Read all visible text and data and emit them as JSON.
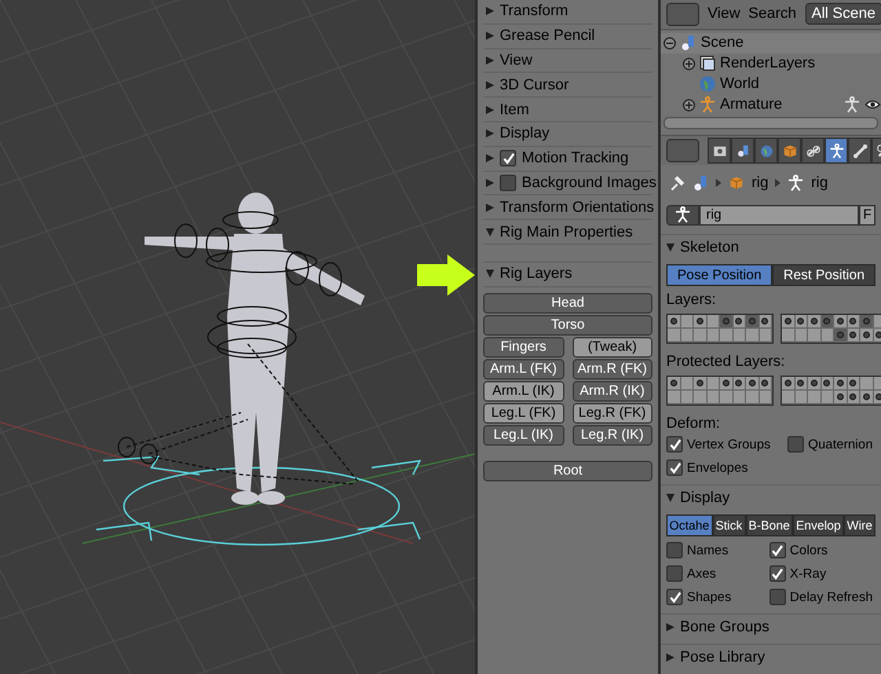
{
  "tool_shelf": {
    "panels": [
      {
        "title": "Transform",
        "expanded": false,
        "kind": "plain"
      },
      {
        "title": "Grease Pencil",
        "expanded": false,
        "kind": "plain"
      },
      {
        "title": "View",
        "expanded": false,
        "kind": "plain"
      },
      {
        "title": "3D Cursor",
        "expanded": false,
        "kind": "plain"
      },
      {
        "title": "Item",
        "expanded": false,
        "kind": "plain"
      },
      {
        "title": "Display",
        "expanded": false,
        "kind": "plain"
      },
      {
        "title": "Motion Tracking",
        "expanded": false,
        "kind": "checkbox",
        "checked": true
      },
      {
        "title": "Background Images",
        "expanded": false,
        "kind": "checkbox",
        "checked": false
      },
      {
        "title": "Transform Orientations",
        "expanded": false,
        "kind": "plain"
      },
      {
        "title": "Rig Main Properties",
        "expanded": true,
        "kind": "plain"
      }
    ],
    "rig_layers": {
      "title": "Rig Layers",
      "expanded": true,
      "rows": [
        [
          {
            "label": "Head",
            "selected": true
          }
        ],
        [
          {
            "label": "Torso",
            "selected": true
          }
        ],
        [
          {
            "label": "Fingers",
            "selected": true
          },
          {
            "label": "(Tweak)",
            "selected": false
          }
        ],
        [
          {
            "label": "Arm.L (FK)",
            "selected": true
          },
          {
            "label": "Arm.R (FK)",
            "selected": true
          }
        ],
        [
          {
            "label": "Arm.L (IK)",
            "selected": false
          },
          {
            "label": "Arm.R (IK)",
            "selected": true
          }
        ],
        [
          {
            "label": "Leg.L (FK)",
            "selected": false
          },
          {
            "label": "Leg.R (FK)",
            "selected": false
          }
        ],
        [
          {
            "label": "Leg.L (IK)",
            "selected": true
          },
          {
            "label": "Leg.R (IK)",
            "selected": true
          }
        ]
      ],
      "root_row": [
        {
          "label": "Root",
          "selected": true
        }
      ]
    }
  },
  "outliner": {
    "menus": [
      "View",
      "Search"
    ],
    "scene_filter": "All Scene",
    "tree": [
      {
        "label": "Scene",
        "kind": "scene",
        "expanded": true,
        "children": [
          {
            "label": "RenderLayers",
            "kind": "render_layers",
            "expanded": false
          },
          {
            "label": "World",
            "kind": "world"
          },
          {
            "label": "Armature",
            "kind": "armature",
            "expanded": false
          }
        ]
      }
    ]
  },
  "properties": {
    "tabs": [
      {
        "kind": "render",
        "selected": false
      },
      {
        "kind": "scene",
        "selected": false
      },
      {
        "kind": "world",
        "selected": false
      },
      {
        "kind": "object",
        "selected": false
      },
      {
        "kind": "constraint",
        "selected": false
      },
      {
        "kind": "armature",
        "selected": true
      },
      {
        "kind": "bone",
        "selected": false
      },
      {
        "kind": "bone_constraint",
        "selected": false
      }
    ],
    "breadcrumb": [
      "rig",
      "rig"
    ],
    "name_field": {
      "value": "rig",
      "button": "F"
    },
    "skeleton": {
      "title": "Skeleton",
      "expanded": true,
      "positions": [
        {
          "label": "Pose Position",
          "selected": true
        },
        {
          "label": "Rest Position",
          "selected": false
        }
      ],
      "layers_label": "Layers:",
      "layers": [
        [
          [
            {
              "used": true,
              "active": false
            },
            {
              "used": false,
              "active": false
            },
            {
              "used": true,
              "active": false
            },
            {
              "used": false,
              "active": false
            },
            {
              "used": true,
              "active": true
            },
            {
              "used": true,
              "active": false
            },
            {
              "used": true,
              "active": true
            },
            {
              "used": true,
              "active": false
            }
          ],
          [
            {
              "used": false,
              "active": false
            },
            {
              "used": false,
              "active": false
            },
            {
              "used": false,
              "active": false
            },
            {
              "used": false,
              "active": false
            },
            {
              "used": false,
              "active": false
            },
            {
              "used": false,
              "active": false
            },
            {
              "used": false,
              "active": false
            },
            {
              "used": false,
              "active": false
            }
          ]
        ],
        [
          [
            {
              "used": true,
              "active": false
            },
            {
              "used": true,
              "active": false
            },
            {
              "used": true,
              "active": false
            },
            {
              "used": true,
              "active": true
            },
            {
              "used": true,
              "active": false
            },
            {
              "used": true,
              "active": false
            },
            {
              "used": true,
              "active": true
            },
            {
              "used": false,
              "active": false
            }
          ],
          [
            {
              "used": false,
              "active": false
            },
            {
              "used": false,
              "active": false
            },
            {
              "used": false,
              "active": false
            },
            {
              "used": false,
              "active": false
            },
            {
              "used": true,
              "active": true
            },
            {
              "used": true,
              "active": false
            },
            {
              "used": true,
              "active": false
            },
            {
              "used": true,
              "active": false
            }
          ]
        ]
      ],
      "protected_label": "Protected Layers:",
      "protected_layers": [
        [
          [
            {
              "used": true,
              "active": false
            },
            {
              "used": false,
              "active": false
            },
            {
              "used": true,
              "active": false
            },
            {
              "used": false,
              "active": false
            },
            {
              "used": true,
              "active": false
            },
            {
              "used": true,
              "active": false
            },
            {
              "used": true,
              "active": false
            },
            {
              "used": true,
              "active": false
            }
          ],
          [
            {
              "used": false,
              "active": false
            },
            {
              "used": false,
              "active": false
            },
            {
              "used": false,
              "active": false
            },
            {
              "used": false,
              "active": false
            },
            {
              "used": false,
              "active": false
            },
            {
              "used": false,
              "active": false
            },
            {
              "used": false,
              "active": false
            },
            {
              "used": false,
              "active": false
            }
          ]
        ],
        [
          [
            {
              "used": true,
              "active": false
            },
            {
              "used": true,
              "active": false
            },
            {
              "used": true,
              "active": false
            },
            {
              "used": true,
              "active": false
            },
            {
              "used": true,
              "active": false
            },
            {
              "used": true,
              "active": false
            },
            {
              "used": false,
              "active": false
            },
            {
              "used": false,
              "active": false
            }
          ],
          [
            {
              "used": false,
              "active": false
            },
            {
              "used": false,
              "active": false
            },
            {
              "used": false,
              "active": false
            },
            {
              "used": false,
              "active": false
            },
            {
              "used": true,
              "active": false
            },
            {
              "used": true,
              "active": false
            },
            {
              "used": true,
              "active": false
            },
            {
              "used": true,
              "active": false
            }
          ]
        ]
      ],
      "deform_label": "Deform:",
      "deform": [
        {
          "label": "Vertex Groups",
          "checked": true
        },
        {
          "label": "Quaternion",
          "checked": false
        },
        {
          "label": "Envelopes",
          "checked": true
        }
      ]
    },
    "display": {
      "title": "Display",
      "expanded": true,
      "modes": [
        {
          "label": "Octahe",
          "selected": true
        },
        {
          "label": "Stick",
          "selected": false
        },
        {
          "label": "B-Bone",
          "selected": false
        },
        {
          "label": "Envelop",
          "selected": false
        },
        {
          "label": "Wire",
          "selected": false
        }
      ],
      "options": [
        {
          "label": "Names",
          "checked": false
        },
        {
          "label": "Colors",
          "checked": true
        },
        {
          "label": "Axes",
          "checked": false
        },
        {
          "label": "X-Ray",
          "checked": true
        },
        {
          "label": "Shapes",
          "checked": true
        },
        {
          "label": "Delay Refresh",
          "checked": false
        }
      ]
    },
    "collapsed_panels": [
      {
        "title": "Bone Groups",
        "expanded": false
      },
      {
        "title": "Pose Library",
        "expanded": false
      }
    ]
  }
}
